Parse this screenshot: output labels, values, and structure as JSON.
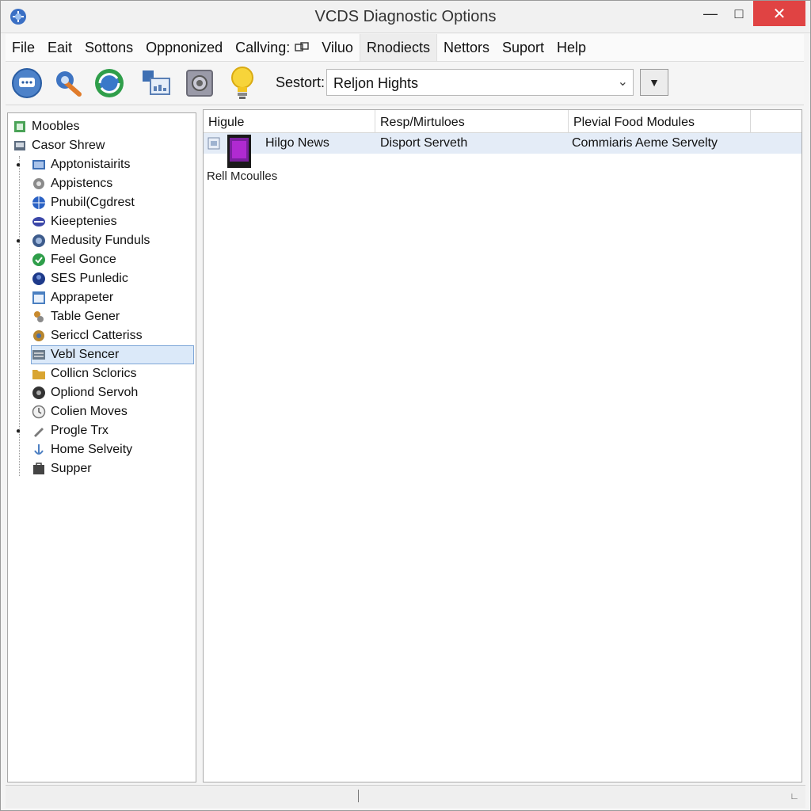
{
  "window": {
    "title": "VCDS Diagnostic Options",
    "minimize_glyph": "—",
    "maximize_glyph": "□",
    "close_glyph": "✕"
  },
  "menu": {
    "items": [
      {
        "label": "File"
      },
      {
        "label": "Eait"
      },
      {
        "label": "Sottons"
      },
      {
        "label": "Oppnonized"
      },
      {
        "label": "Callving:"
      },
      {
        "label": "Viluo"
      },
      {
        "label": "Rnodiects"
      },
      {
        "label": "Nettors"
      },
      {
        "label": "Suport"
      },
      {
        "label": "Help"
      }
    ]
  },
  "toolbar": {
    "search_label": "Sestort:",
    "search_value": "Reljon Hights",
    "icons": [
      "chat-icon",
      "wrench-icon",
      "refresh-globe-icon",
      "monitor-icon",
      "camera-icon",
      "lightbulb-icon"
    ]
  },
  "tree": {
    "items": [
      {
        "label": "Moobles",
        "icon": "modules-icon",
        "color": "#4aa357"
      },
      {
        "label": "Casor Shrew",
        "icon": "sensor-icon",
        "color": "#5b6b7e"
      },
      {
        "label": "Apptonistairits",
        "icon": "app-icon",
        "color": "#3d6fb5"
      },
      {
        "label": "Appistencs",
        "icon": "gear-icon",
        "color": "#8a8a8a"
      },
      {
        "label": "Pnubil(Cgdrest",
        "icon": "globe-icon",
        "color": "#2b62c4"
      },
      {
        "label": "Kieeptenies",
        "icon": "key-icon",
        "color": "#3b47a8"
      },
      {
        "label": "Medusity Funduls",
        "icon": "world-icon",
        "color": "#3e5c8c"
      },
      {
        "label": "Feel Gonce",
        "icon": "check-icon",
        "color": "#2f9e4a"
      },
      {
        "label": "SES Punledic",
        "icon": "circle-icon",
        "color": "#1e3a8a"
      },
      {
        "label": "Apprapeter",
        "icon": "window-icon",
        "color": "#4a7fc1"
      },
      {
        "label": "Table Gener",
        "icon": "table-icon",
        "color": "#c88a2e"
      },
      {
        "label": "Sericcl Catteriss",
        "icon": "settings-icon",
        "color": "#b8862e"
      },
      {
        "label": "Vebl Sencer",
        "icon": "sensor-panel-icon",
        "color": "#6a7a8a"
      },
      {
        "label": "Collicn Sclorics",
        "icon": "folder-icon",
        "color": "#d9a531"
      },
      {
        "label": "Opliond Servoh",
        "icon": "disc-icon",
        "color": "#333333"
      },
      {
        "label": "Colien Moves",
        "icon": "clock-icon",
        "color": "#888888"
      },
      {
        "label": "Progle Trx",
        "icon": "pencil-icon",
        "color": "#7a7a7a"
      },
      {
        "label": "Home Selveity",
        "icon": "anchor-icon",
        "color": "#4d7fc2"
      },
      {
        "label": "Supper",
        "icon": "toolbox-icon",
        "color": "#444444"
      }
    ]
  },
  "list": {
    "columns": [
      "Higule",
      "Resp/Mirtuloes",
      "Plevial Food Modules"
    ],
    "rows": [
      {
        "c1": "Hilgo News",
        "c2": "Disport Serveth",
        "c3": "Commiaris Aeme Servelty"
      }
    ],
    "subtitle": "Rell Mcoulles"
  },
  "colors": {
    "selection": "#dbe9f9",
    "close_button": "#e04343"
  }
}
